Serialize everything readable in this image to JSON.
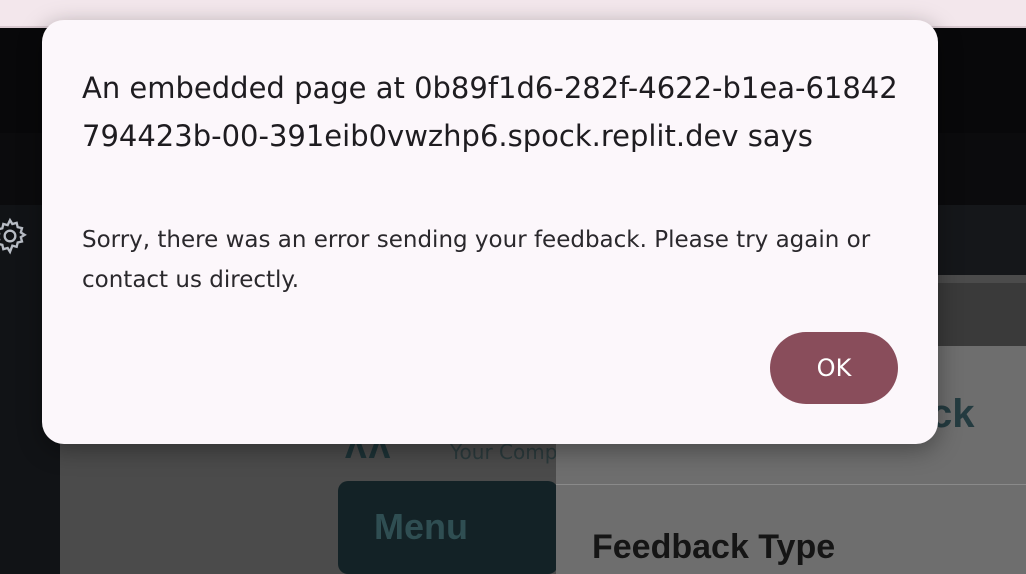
{
  "alert": {
    "title": "An embedded page at 0b89f1d6-282f-4622-b1ea-61842794423b-00-391eib0vwzhp6.spock.replit.dev says",
    "message": "Sorry, there was an error sending your feedback. Please try again or contact us directly.",
    "ok_label": "OK"
  },
  "background": {
    "settings_icon": "gear-icon",
    "company_text": "Your Comp",
    "menu_label": "Menu",
    "feedback_title_fragment": "ck",
    "feedback_type_label": "Feedback Type"
  },
  "colors": {
    "dialog_bg": "#fcf7fb",
    "ok_button": "#894d5b",
    "top_strip": "#f3e7ec"
  }
}
